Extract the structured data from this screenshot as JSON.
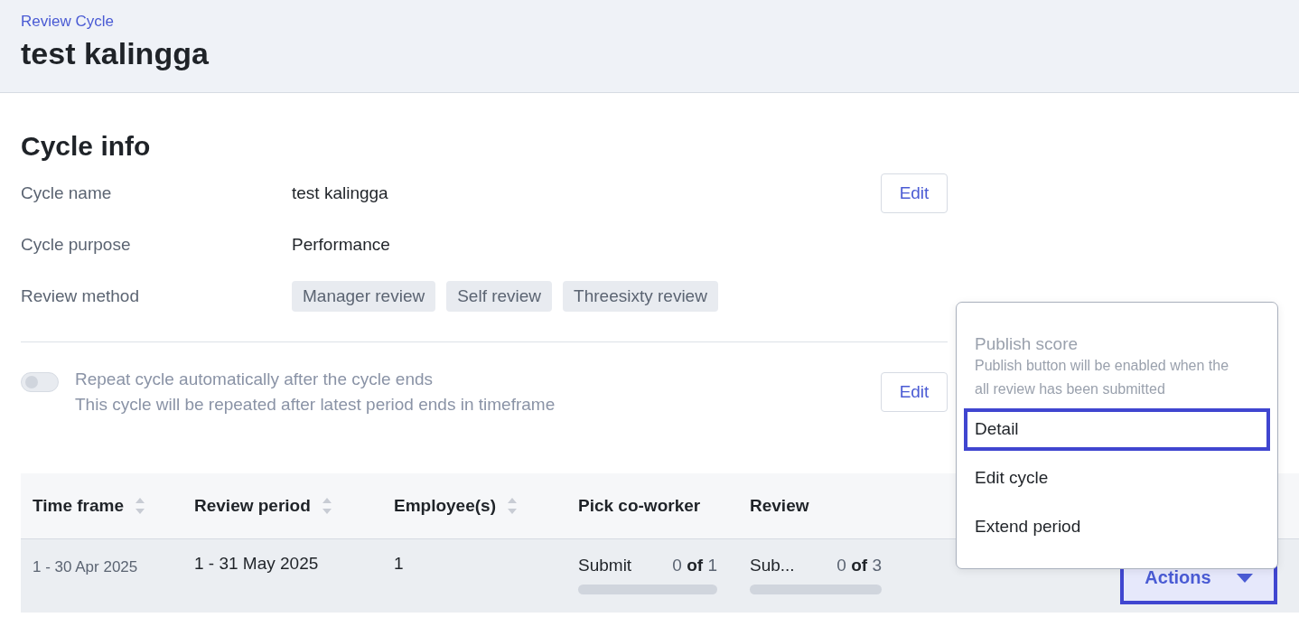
{
  "header": {
    "breadcrumb": "Review Cycle",
    "title": "test kalingga"
  },
  "cycle_info": {
    "heading": "Cycle info",
    "rows": [
      {
        "label": "Cycle name",
        "kind": "text",
        "value": "test kalingga",
        "edit": "Edit"
      },
      {
        "label": "Cycle purpose",
        "kind": "text",
        "value": "Performance"
      },
      {
        "label": "Review method",
        "kind": "tags",
        "tags": [
          "Manager review",
          "Self review",
          "Threesixty review"
        ]
      }
    ]
  },
  "repeat": {
    "on": false,
    "title": "Repeat cycle automatically after the cycle ends",
    "description": "This cycle will be repeated after latest period ends in timeframe",
    "edit": "Edit"
  },
  "table": {
    "columns": [
      {
        "label": "Time frame",
        "sortable": true
      },
      {
        "label": "Review period",
        "sortable": true
      },
      {
        "label": "Employee(s)",
        "sortable": true
      },
      {
        "label": "Pick co-worker",
        "sortable": false
      },
      {
        "label": "Review",
        "sortable": false
      }
    ],
    "rows": [
      {
        "time_frame": "1 - 30 Apr 2025",
        "review_period": "1 - 31 May 2025",
        "employees": "1",
        "pick_coworker": {
          "label": "Submit",
          "count": "0 **of** 1",
          "level": 0
        },
        "review": {
          "label": "Sub...",
          "count": "0 **of** 3",
          "level": 0
        },
        "actions": {
          "label": "Actions",
          "highlighted": true
        }
      }
    ]
  },
  "menu": {
    "items": [
      {
        "label": "Publish score",
        "description": "Publish button will be enabled when the all review has been submitted",
        "disabled": true,
        "highlighted": false
      },
      {
        "label": "Detail",
        "disabled": false,
        "highlighted": true
      },
      {
        "label": "Edit cycle",
        "disabled": false,
        "highlighted": false
      },
      {
        "label": "Extend period",
        "disabled": false,
        "highlighted": false
      }
    ]
  }
}
